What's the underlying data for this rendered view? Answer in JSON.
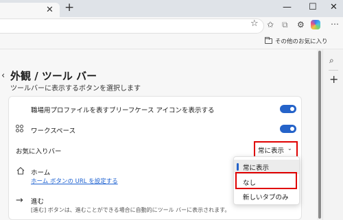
{
  "window": {
    "tab_close": "✕",
    "new_tab": "+",
    "minimize": "—",
    "maximize": "☐",
    "close": "✕"
  },
  "favorites_bar": {
    "folder_label": "その他のお気に入り"
  },
  "settings": {
    "back": "‹",
    "title": "外観 / ツール バー",
    "subtitle": "ツールバーに表示するボタンを選択します",
    "rows": {
      "work_profile": "職場用プロファイルを表すブリーフケース アイコンを表示する",
      "workspaces": "ワークスペース",
      "favorites_bar": "お気に入りバー",
      "home": "ホーム",
      "home_link": "ホーム ボタンの URL を設定する",
      "forward": "進む",
      "forward_desc": "[進む] ボタンは、進むことができる場合に自動的にツール バーに表示されます。"
    },
    "toggles": {
      "work_profile": true,
      "workspaces": true
    },
    "dropdown": {
      "selected": "常に表示",
      "options": [
        "常に表示",
        "なし",
        "新しいタブのみ"
      ]
    }
  },
  "colors": {
    "accent": "#2563c9",
    "highlight_box": "#e00000"
  }
}
